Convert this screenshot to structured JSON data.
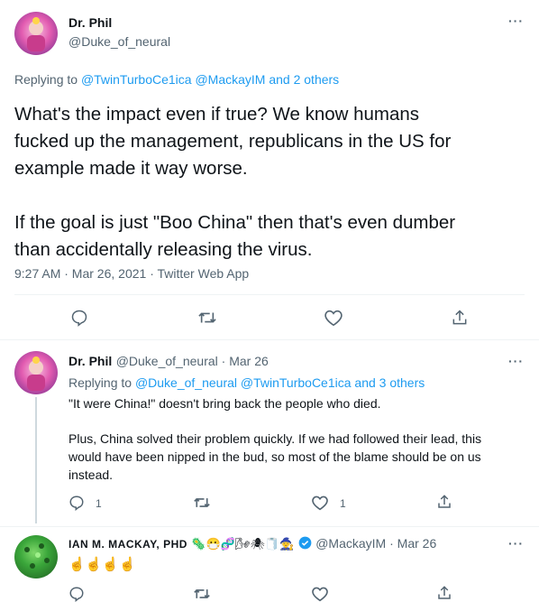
{
  "main_tweet": {
    "display_name": "Dr. Phil",
    "handle": "@Duke_of_neural",
    "replying_prefix": "Replying to ",
    "replying_to": "@TwinTurboCe1ica @MackayIM and 2 others",
    "text_line1": "What's the impact even if true? We know humans",
    "text_line2": "fucked up the management, republicans in the US for",
    "text_line3": "example made it way worse.",
    "text_line4": "If the goal is just \"Boo China\" then that's even dumber",
    "text_line5": "than accidentally releasing the virus.",
    "meta": "9:27 AM · Mar 26, 2021 · Twitter Web App"
  },
  "reply1": {
    "display_name": "Dr. Phil",
    "handle_date": "@Duke_of_neural · Mar 26",
    "replying_prefix": "Replying to ",
    "replying_to": "@Duke_of_neural @TwinTurboCe1ica and 3 others",
    "line1": "\"It were China!\" doesn't bring back the people who died.",
    "line2": "Plus, China solved their problem quickly. If we had followed their lead, this",
    "line3": "would have been nipped in the bud, so most of the blame should be on us",
    "line4": "instead.",
    "reply_count": "1",
    "like_count": "1"
  },
  "reply2": {
    "display_name": "IAN M. MACKAY, PHD",
    "name_emojis": "🦠😷🧬🌬🕷🧻🧙",
    "handle_date": "@MackayIM · Mar 26",
    "text": "☝️☝️☝️☝️"
  },
  "colors": {
    "accent": "#1d9bf0",
    "muted": "#536471",
    "text": "#0f1419"
  },
  "icons": [
    "more-icon",
    "reply-icon",
    "retweet-icon",
    "like-icon",
    "share-icon",
    "verified-icon"
  ]
}
